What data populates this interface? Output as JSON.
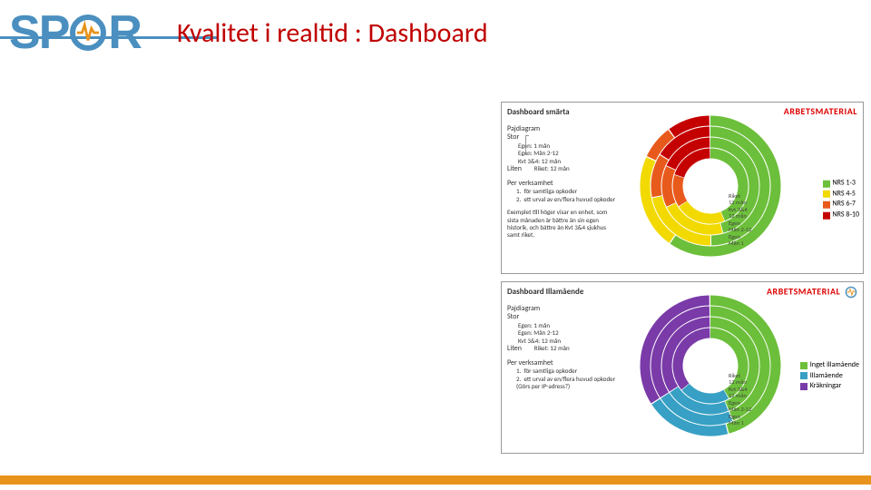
{
  "header": {
    "title": "Kvalitet i realtid : Dashboard"
  },
  "logo": {
    "letters": [
      "S",
      "P",
      "R"
    ],
    "icon_name": "pulse-icon"
  },
  "watermark": "ARBETSMATERIAL",
  "panels": {
    "smarta": {
      "title": "Dashboard smärta",
      "pajdiagram_label": "Pajdiagram",
      "stor_label": "Stor",
      "liten_label": "Liten",
      "stor_lines": [
        "Egen: 1 mån",
        "Egen: Mån 2-12",
        "Kvt 3&4: 12 mån"
      ],
      "liten_line": "Riket: 12 mån",
      "per_label": "Per verksamhet",
      "per_items": [
        "för samtliga opkoder",
        "ett urval av en/flera huvud opkoder"
      ],
      "example": "Exemplet till höger visar en enhet, som sista månaden är bättre än sin egen historik, och bättre än Kvt 3&4 sjukhus samt riket.",
      "legend": [
        {
          "label": "NRS 1-3",
          "color": "#6cbf3a"
        },
        {
          "label": "NRS 4-5",
          "color": "#f2d900"
        },
        {
          "label": "NRS 6-7",
          "color": "#e85a1c"
        },
        {
          "label": "NRS 8-10",
          "color": "#c40000"
        }
      ],
      "ring_labels": [
        "Riket",
        "12 mån",
        "Kvt 3&4",
        "12 mån",
        "Egen",
        "Mån 2-12",
        "Egen",
        "Mån 1"
      ]
    },
    "illamaende": {
      "title": "Dashboard Illamående",
      "pajdiagram_label": "Pajdiagram",
      "stor_label": "Stor",
      "liten_label": "Liten",
      "stor_lines": [
        "Egen: 1 mån",
        "Egen: Mån 2-12",
        "Kvt 3&4: 12 mån"
      ],
      "liten_line": "Riket: 12 mån",
      "per_label": "Per verksamhet",
      "per_items": [
        "för samtliga opkoder",
        "ett urval av en/flera huvud opkoder (Görs per IP-adress?)"
      ],
      "legend": [
        {
          "label": "Inget illamående",
          "color": "#6cbf3a"
        },
        {
          "label": "Illamående",
          "color": "#37a0c4"
        },
        {
          "label": "Kräkningar",
          "color": "#7a3aa8"
        }
      ],
      "ring_labels": [
        "Riket",
        "12 mån",
        "Kvt 3&4",
        "12 mån",
        "Egen",
        "Mån 2-12",
        "Egen",
        "Mån 1"
      ]
    }
  },
  "chart_data": [
    {
      "type": "pie",
      "title": "Dashboard smärta",
      "series_note": "Four concentric donuts: outer→inner = Egen Mån 1, Egen Mån 2-12, Kvt 3&4 12 mån, Riket 12 mån",
      "categories": [
        "NRS 1-3",
        "NRS 4-5",
        "NRS 6-7",
        "NRS 8-10"
      ],
      "colors": [
        "#6cbf3a",
        "#f2d900",
        "#e85a1c",
        "#c40000"
      ],
      "rings": [
        {
          "name": "Egen Mån 1",
          "values": [
            60,
            22,
            8,
            10
          ]
        },
        {
          "name": "Egen Mån 2-12",
          "values": [
            50,
            22,
            12,
            16
          ]
        },
        {
          "name": "Kvt 3&4 12 mån",
          "values": [
            46,
            22,
            14,
            18
          ]
        },
        {
          "name": "Riket 12 mån",
          "values": [
            44,
            22,
            14,
            20
          ]
        }
      ]
    },
    {
      "type": "pie",
      "title": "Dashboard Illamående",
      "series_note": "Four concentric donuts: outer→inner = Egen Mån 1, Egen Mån 2-12, Kvt 3&4 12 mån, Riket 12 mån",
      "categories": [
        "Inget illamående",
        "Illamående",
        "Kräkningar"
      ],
      "colors": [
        "#6cbf3a",
        "#37a0c4",
        "#7a3aa8"
      ],
      "rings": [
        {
          "name": "Egen Mån 1",
          "values": [
            46,
            20,
            34
          ]
        },
        {
          "name": "Egen Mån 2-12",
          "values": [
            44,
            22,
            34
          ]
        },
        {
          "name": "Kvt 3&4 12 mån",
          "values": [
            44,
            22,
            34
          ]
        },
        {
          "name": "Riket 12 mån",
          "values": [
            42,
            22,
            36
          ]
        }
      ]
    }
  ]
}
